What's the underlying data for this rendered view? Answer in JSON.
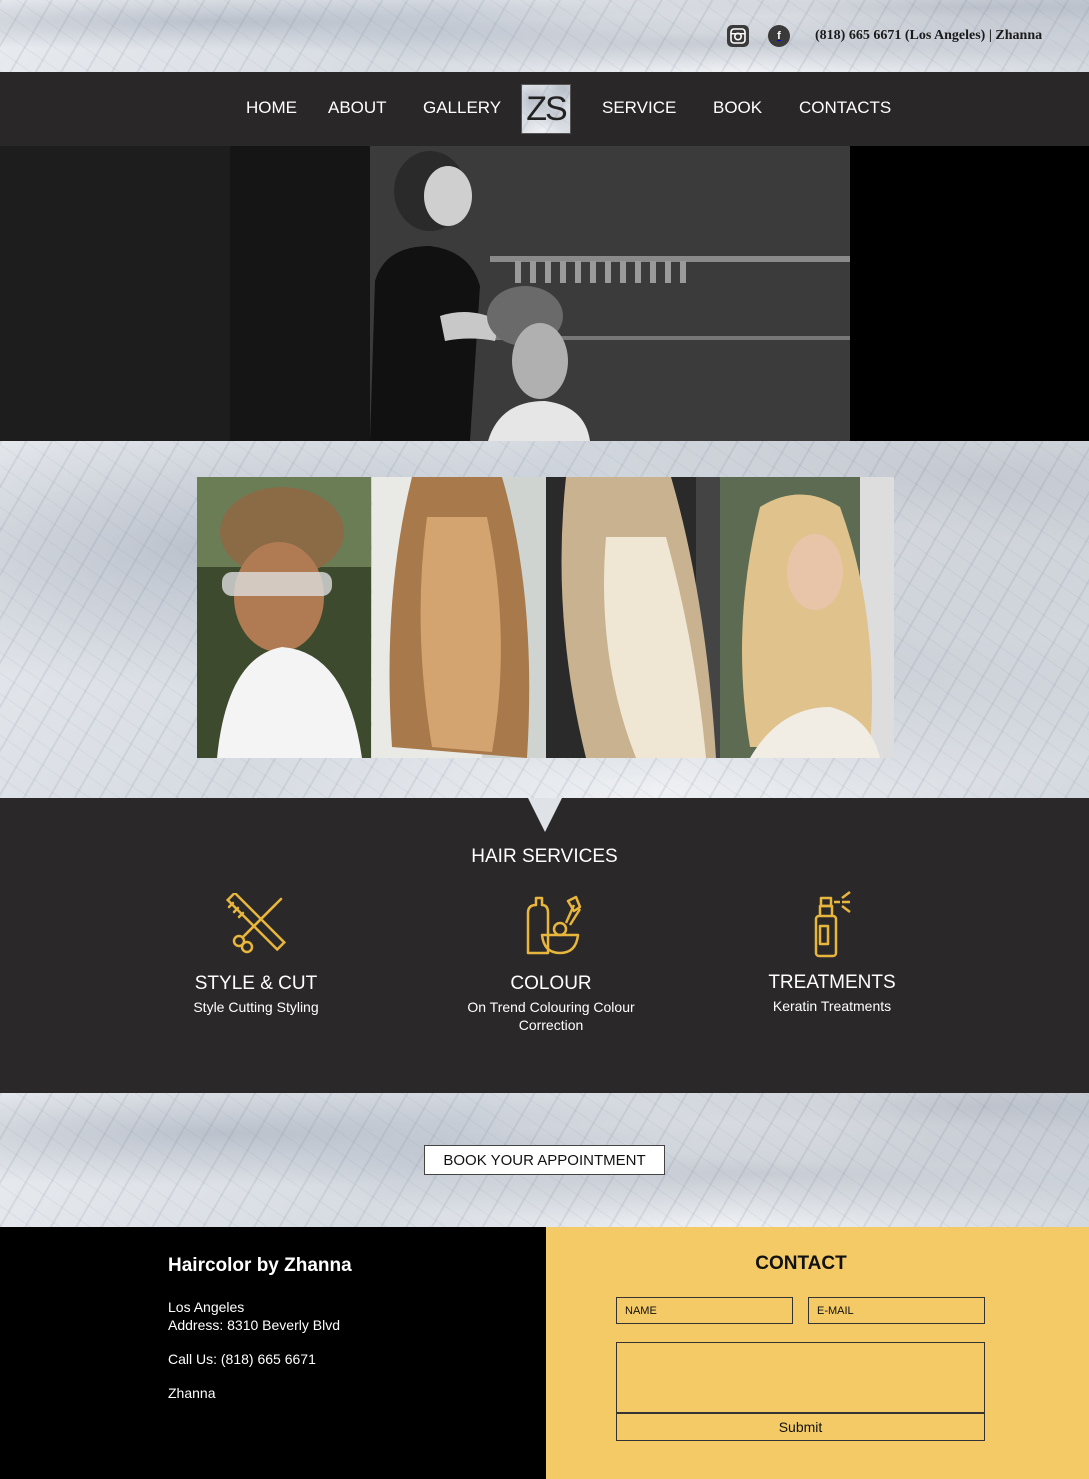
{
  "header": {
    "phone_text": "(818) 665 6671 (Los Angeles) | Zhanna",
    "social": [
      {
        "icon": "instagram-icon"
      },
      {
        "icon": "facebook-icon",
        "glyph": "f"
      }
    ]
  },
  "nav": {
    "items": [
      "HOME",
      "ABOUT",
      "GALLERY",
      "SERVICE",
      "BOOK",
      "CONTACTS"
    ],
    "logo_text": "ZS"
  },
  "services": {
    "title": "HAIR SERVICES",
    "items": [
      {
        "name": "STYLE & CUT",
        "desc": "Style Cutting Styling",
        "icon": "scissors-comb-icon"
      },
      {
        "name": "COLOUR",
        "desc": "On Trend Colouring Colour Correction",
        "icon": "hair-dye-kit-icon"
      },
      {
        "name": "TREATMENTS",
        "desc": "Keratin Treatments",
        "icon": "spray-bottle-icon"
      }
    ],
    "icon_color": "#e8b63c"
  },
  "book": {
    "button_label": "BOOK YOUR APPOINTMENT"
  },
  "footer": {
    "business_name": "Haircolor by Zhanna",
    "city": "Los Angeles",
    "address": "Address: 8310 Beverly Blvd",
    "call": "Call Us: (818) 665 6671",
    "owner": "Zhanna"
  },
  "contact": {
    "title": "CONTACT",
    "name_placeholder": "NAME",
    "email_placeholder": "E-MAIL",
    "submit_label": "Submit",
    "background": "#f3ca66"
  }
}
